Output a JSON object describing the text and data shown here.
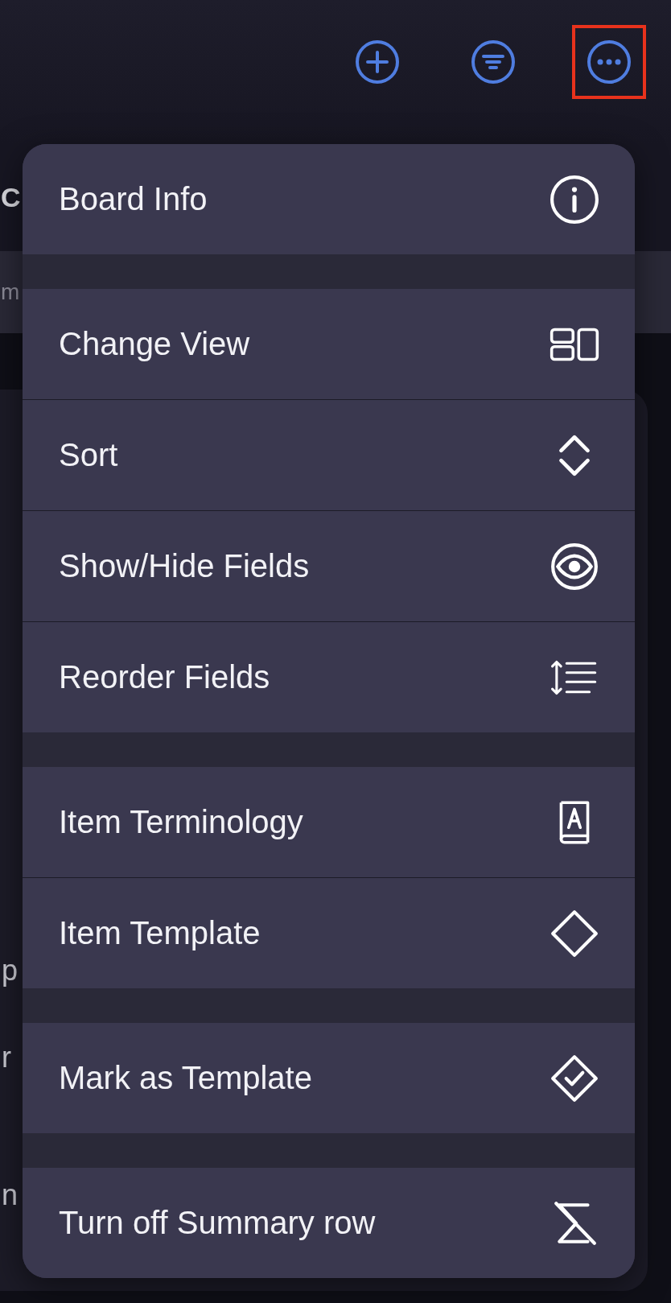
{
  "toolbar": {
    "buttons": [
      {
        "kind": "add",
        "highlighted": false
      },
      {
        "kind": "filter",
        "highlighted": false
      },
      {
        "kind": "more",
        "highlighted": true
      }
    ]
  },
  "background": {
    "title": "C",
    "search": "m",
    "rows": [
      "p",
      "r",
      "n"
    ]
  },
  "menu": {
    "groups": [
      [
        {
          "label": "Board Info",
          "kind": "info"
        }
      ],
      [
        {
          "label": "Change View",
          "kind": "view"
        },
        {
          "label": "Sort",
          "kind": "sort"
        },
        {
          "label": "Show/Hide Fields",
          "kind": "eye"
        },
        {
          "label": "Reorder Fields",
          "kind": "reorder"
        }
      ],
      [
        {
          "label": "Item Terminology",
          "kind": "book"
        },
        {
          "label": "Item Template",
          "kind": "diamond"
        }
      ],
      [
        {
          "label": "Mark as Template",
          "kind": "diamond-check"
        }
      ],
      [
        {
          "label": "Turn off Summary row",
          "kind": "sigma"
        }
      ]
    ]
  }
}
